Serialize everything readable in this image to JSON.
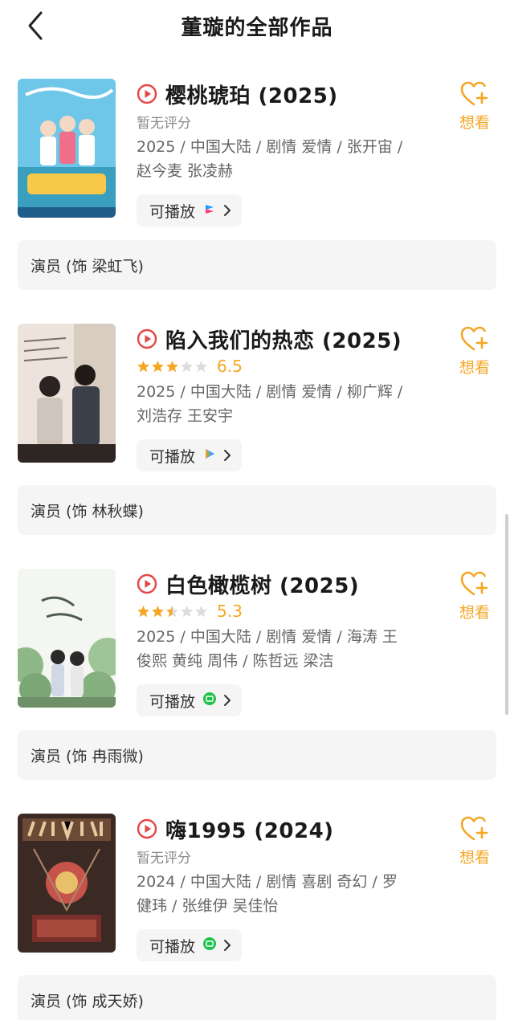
{
  "header": {
    "title": "董璇的全部作品"
  },
  "colors": {
    "accent": "#f5a623",
    "play_red": "#e64545",
    "star_empty": "#dddddd"
  },
  "items": [
    {
      "title": "樱桃琥珀 (2025)",
      "rating_text": "暂无评分",
      "stars": null,
      "score": "",
      "meta": "2025 / 中国大陆 / 剧情 爱情 / 张开宙 / 赵今麦 张凌赫",
      "play_label": "可播放",
      "platform_icon": "youku-icon",
      "want_label": "想看",
      "role": "演员 (饰 梁虹飞)"
    },
    {
      "title": "陷入我们的热恋 (2025)",
      "rating_text": "",
      "stars": 3,
      "score": "6.5",
      "meta": "2025 / 中国大陆 / 剧情 爱情 / 柳广辉 / 刘浩存 王安宇",
      "play_label": "可播放",
      "platform_icon": "tencent-video-icon",
      "want_label": "想看",
      "role": "演员 (饰 林秋蝶)"
    },
    {
      "title": "白色橄榄树 (2025)",
      "rating_text": "",
      "stars": 2.5,
      "score": "5.3",
      "meta": "2025 / 中国大陆 / 剧情 爱情 / 海涛 王俊熙 黄纯 周伟 / 陈哲远 梁洁",
      "play_label": "可播放",
      "platform_icon": "iqiyi-icon",
      "want_label": "想看",
      "role": "演员 (饰 冉雨微)"
    },
    {
      "title": "嗨1995 (2024)",
      "rating_text": "暂无评分",
      "stars": null,
      "score": "",
      "meta": "2024 / 中国大陆 / 剧情 喜剧 奇幻 / 罗健玮 / 张维伊 吴佳怡",
      "play_label": "可播放",
      "platform_icon": "iqiyi-icon",
      "want_label": "想看",
      "role": "演员 (饰 成天娇)"
    }
  ]
}
